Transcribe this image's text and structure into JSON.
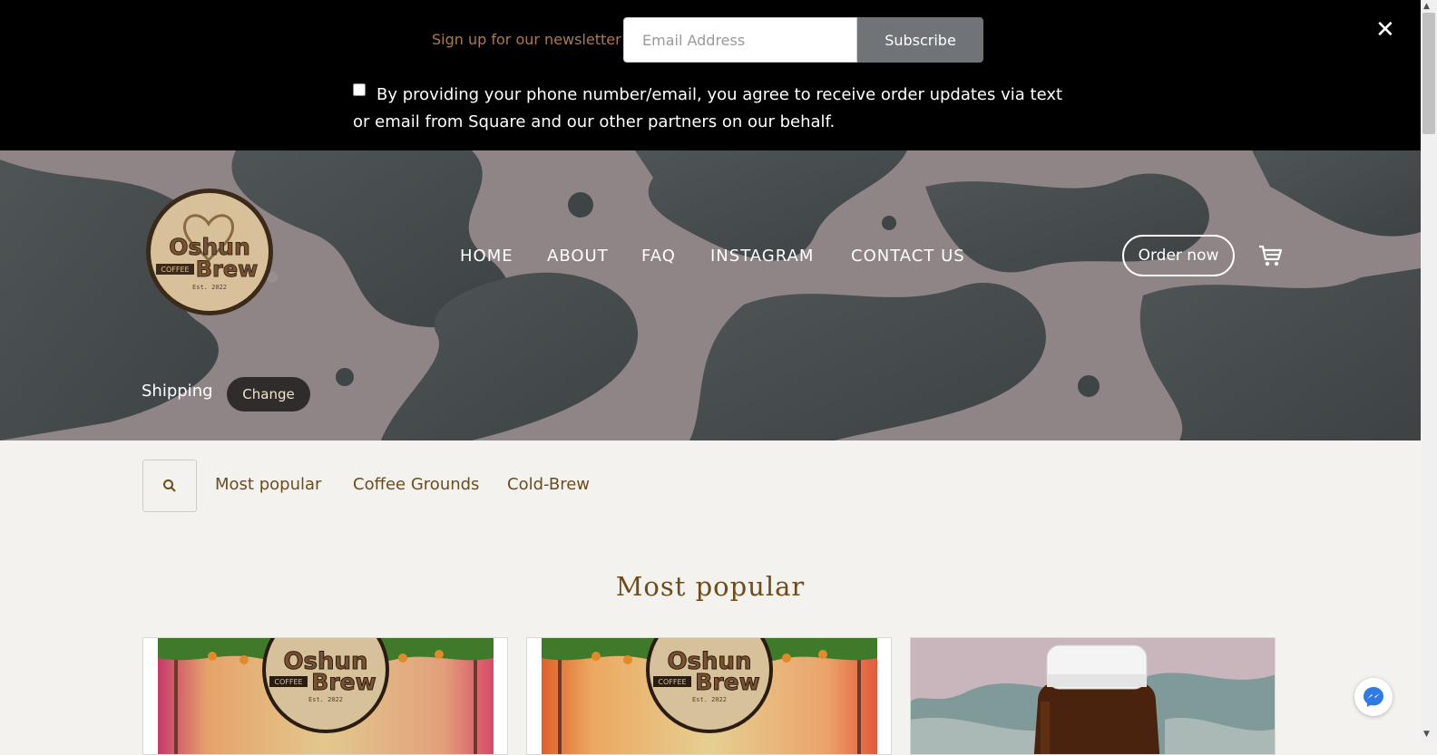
{
  "newsletter": {
    "label": "Sign up for our newsletter",
    "email_placeholder": "Email Address",
    "subscribe_label": "Subscribe",
    "consent_text": "By providing your phone number/email, you agree to receive order updates via text or email from Square and our other partners on our behalf.",
    "close_label": "✕"
  },
  "header": {
    "nav": [
      "HOME",
      "ABOUT",
      "FAQ",
      "INSTAGRAM",
      "CONTACT US"
    ],
    "order_label": "Order now"
  },
  "shipping": {
    "label": "Shipping",
    "change_label": "Change"
  },
  "categories": [
    "Most popular",
    "Coffee Grounds",
    "Cold-Brew"
  ],
  "section_title": "Most popular",
  "colors": {
    "accent_brown": "#6d4c1c",
    "newsletter_bg": "#000000",
    "subscribe_bg": "#707378"
  },
  "icons": {
    "close": "close-icon",
    "cart": "cart-icon",
    "search": "search-icon",
    "messenger": "messenger-icon"
  }
}
